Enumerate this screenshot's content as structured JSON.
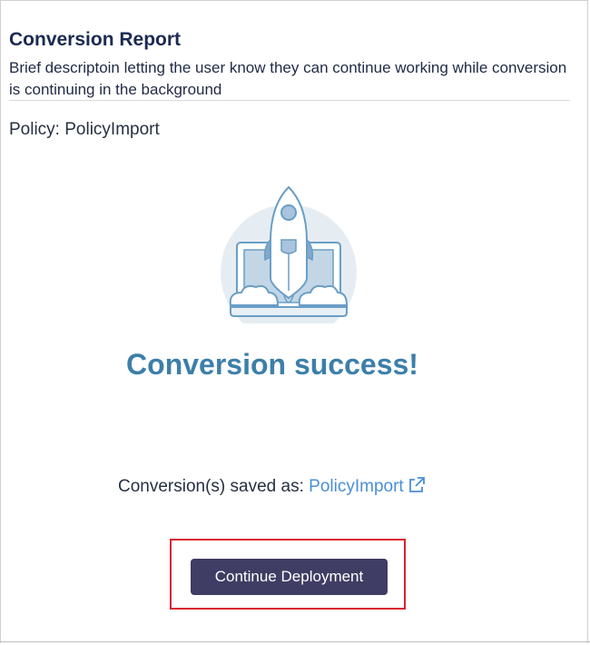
{
  "report": {
    "title": "Conversion Report",
    "description": "Brief descriptoin letting the user know they can continue working while conversion is continuing in the background",
    "policy_label": "Policy: PolicyImport"
  },
  "result": {
    "illustration_icon": "rocket-launch-laptop-icon",
    "success_text": "Conversion success!",
    "saved_prefix": "Conversion(s) saved as: ",
    "saved_link_text": "PolicyImport",
    "external_icon": "external-link-icon"
  },
  "actions": {
    "continue_label": "Continue Deployment"
  },
  "colors": {
    "title": "#1b2a52",
    "success": "#3c7fa9",
    "link": "#4a8fd8",
    "button_bg": "#3f3d63",
    "highlight": "#d9232f"
  }
}
